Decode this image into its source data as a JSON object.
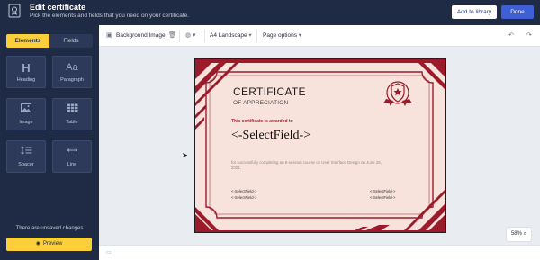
{
  "header": {
    "title": "Edit certificate",
    "subtitle": "Pick the elements and fields that you need on your certificate.",
    "add_to_library": "Add to library",
    "done": "Done"
  },
  "sidebar": {
    "tabs": [
      "Elements",
      "Fields"
    ],
    "tiles": [
      {
        "label": "Heading",
        "icon": "heading-icon"
      },
      {
        "label": "Paragraph",
        "icon": "paragraph-icon"
      },
      {
        "label": "Image",
        "icon": "image-icon"
      },
      {
        "label": "Table",
        "icon": "table-icon"
      },
      {
        "label": "Spacer",
        "icon": "spacer-icon"
      },
      {
        "label": "Line",
        "icon": "line-icon"
      }
    ],
    "unsaved": "There are unsaved changes",
    "preview": "Preview"
  },
  "toolbar": {
    "background_image": "Background Image",
    "orientation": "A4 Landscape",
    "page_options": "Page options"
  },
  "zoom": "58%",
  "certificate": {
    "title": "CERTIFICATE",
    "subtitle": "OF APPRECIATION",
    "awarded": "This certificate is awarded to",
    "name_field": "<-SelectField->",
    "description": "for successfully completing an 8-session course on User Interface Design on June 25, 2021.",
    "sig_left_1": "<-SelectField->",
    "sig_left_2": "<-SelectField->",
    "sig_right_1": "<-SelectField->",
    "sig_right_2": "<-SelectField->"
  },
  "colors": {
    "navy": "#1f2a44",
    "accent_yellow": "#fbcf3a",
    "done_blue": "#3f5fd4",
    "cert_red": "#9b1b2b",
    "cert_bg": "#f7e3dc"
  }
}
